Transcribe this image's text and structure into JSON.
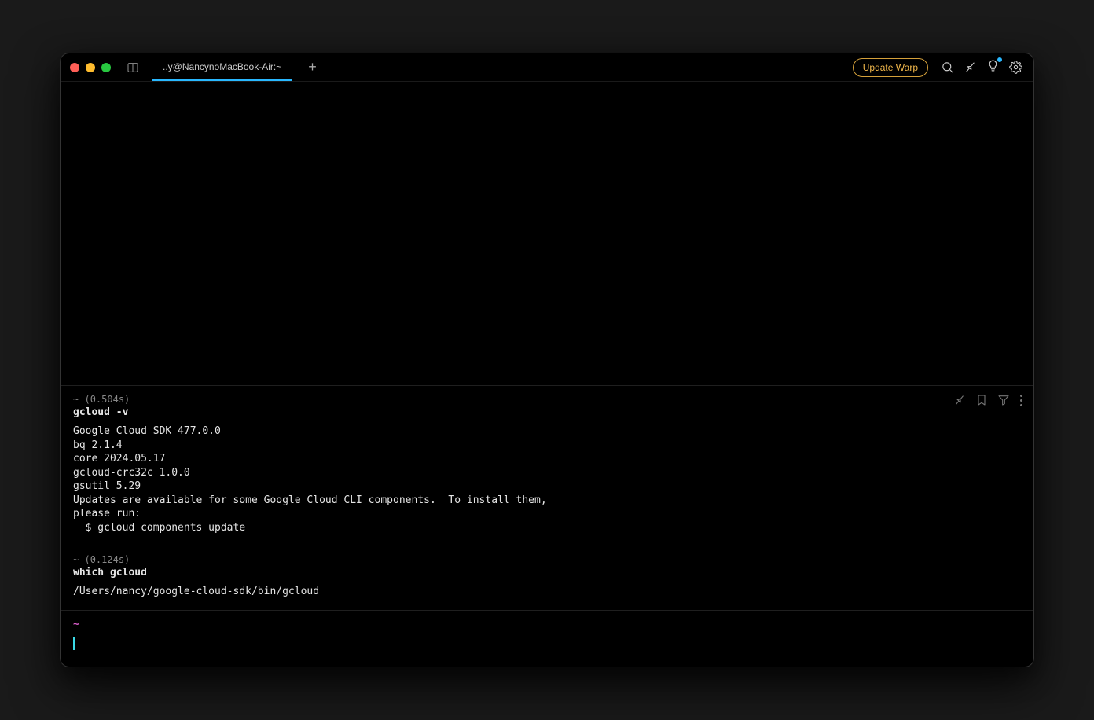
{
  "window": {
    "tab_title": "..y@NancynoMacBook-Air:~",
    "update_label": "Update Warp"
  },
  "blocks": [
    {
      "cwd": "~",
      "timing": "(0.504s)",
      "command": "gcloud -v",
      "output": "Google Cloud SDK 477.0.0\nbq 2.1.4\ncore 2024.05.17\ngcloud-crc32c 1.0.0\ngsutil 5.29\nUpdates are available for some Google Cloud CLI components.  To install them,\nplease run:\n  $ gcloud components update"
    },
    {
      "cwd": "~",
      "timing": "(0.124s)",
      "command": "which gcloud",
      "output": "/Users/nancy/google-cloud-sdk/bin/gcloud"
    }
  ],
  "prompt": {
    "cwd": "~"
  }
}
